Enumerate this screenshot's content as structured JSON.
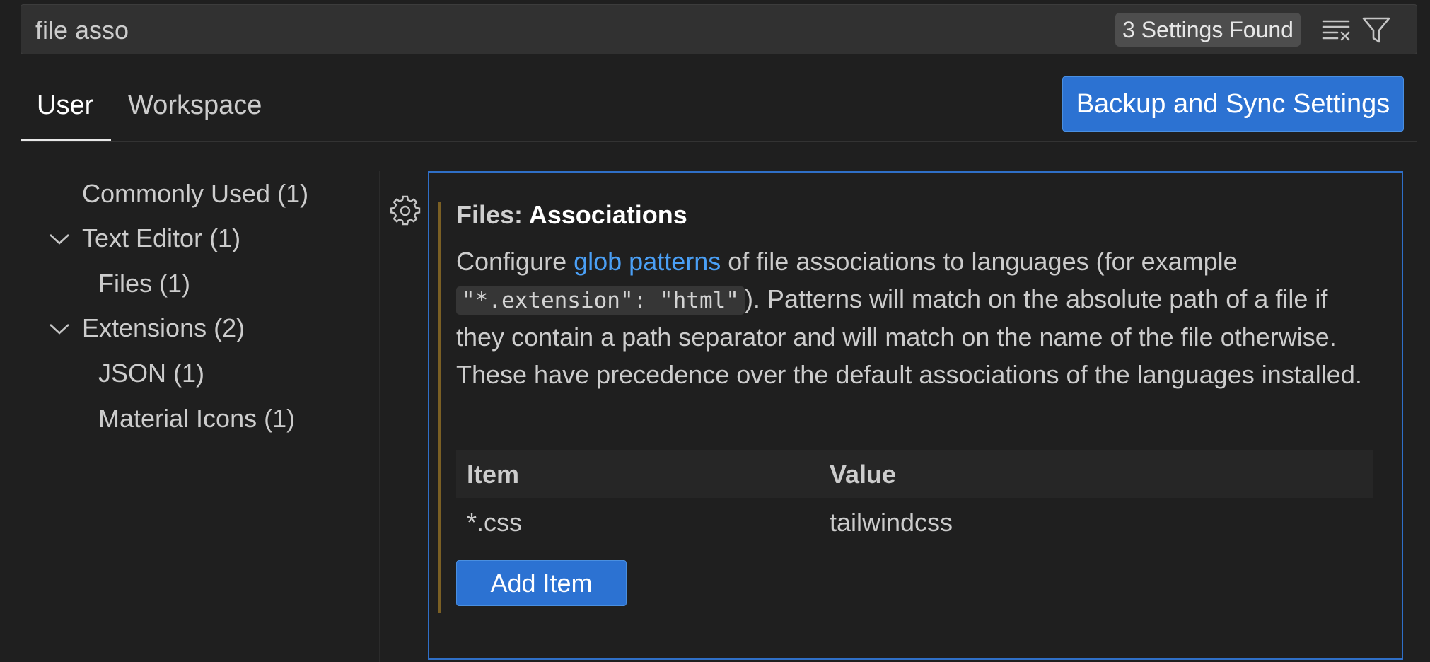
{
  "search": {
    "value": "file asso",
    "results_badge": "3 Settings Found",
    "clear_icon": "clear-filter-icon",
    "filter_icon": "filter-icon"
  },
  "tabs": [
    {
      "label": "User",
      "active": true
    },
    {
      "label": "Workspace",
      "active": false
    }
  ],
  "sync_button_label": "Backup and Sync Settings",
  "toc": {
    "items": [
      {
        "label": "Commonly Used (1)",
        "level": 0,
        "expandable": false
      },
      {
        "label": "Text Editor (1)",
        "level": 0,
        "expandable": true,
        "expanded": true
      },
      {
        "label": "Files (1)",
        "level": 1,
        "expandable": false
      },
      {
        "label": "Extensions (2)",
        "level": 0,
        "expandable": true,
        "expanded": true
      },
      {
        "label": "JSON (1)",
        "level": 1,
        "expandable": false
      },
      {
        "label": "Material Icons (1)",
        "level": 1,
        "expandable": false
      }
    ]
  },
  "setting": {
    "gear_icon": "gear-icon",
    "category": "Files: ",
    "name": "Associations",
    "description": {
      "before_link": "Configure ",
      "link": "glob patterns",
      "after_link": " of file associations to languages (for example ",
      "code": "\"*.extension\": \"html\"",
      "after_code": "). Patterns will match on the absolute path of a file if they contain a path separator and will match on the name of the file otherwise. These have precedence over the default associations of the languages installed."
    },
    "table": {
      "headers": {
        "item": "Item",
        "value": "Value"
      },
      "rows": [
        {
          "item": "*.css",
          "value": "tailwindcss"
        }
      ]
    },
    "add_item_label": "Add Item"
  },
  "colors": {
    "background": "#1f1f1f",
    "accent_button": "#2c72d2",
    "focus_border": "#2f6fc7",
    "link": "#4a9ff5",
    "modified_indicator": "#7a5f24"
  }
}
